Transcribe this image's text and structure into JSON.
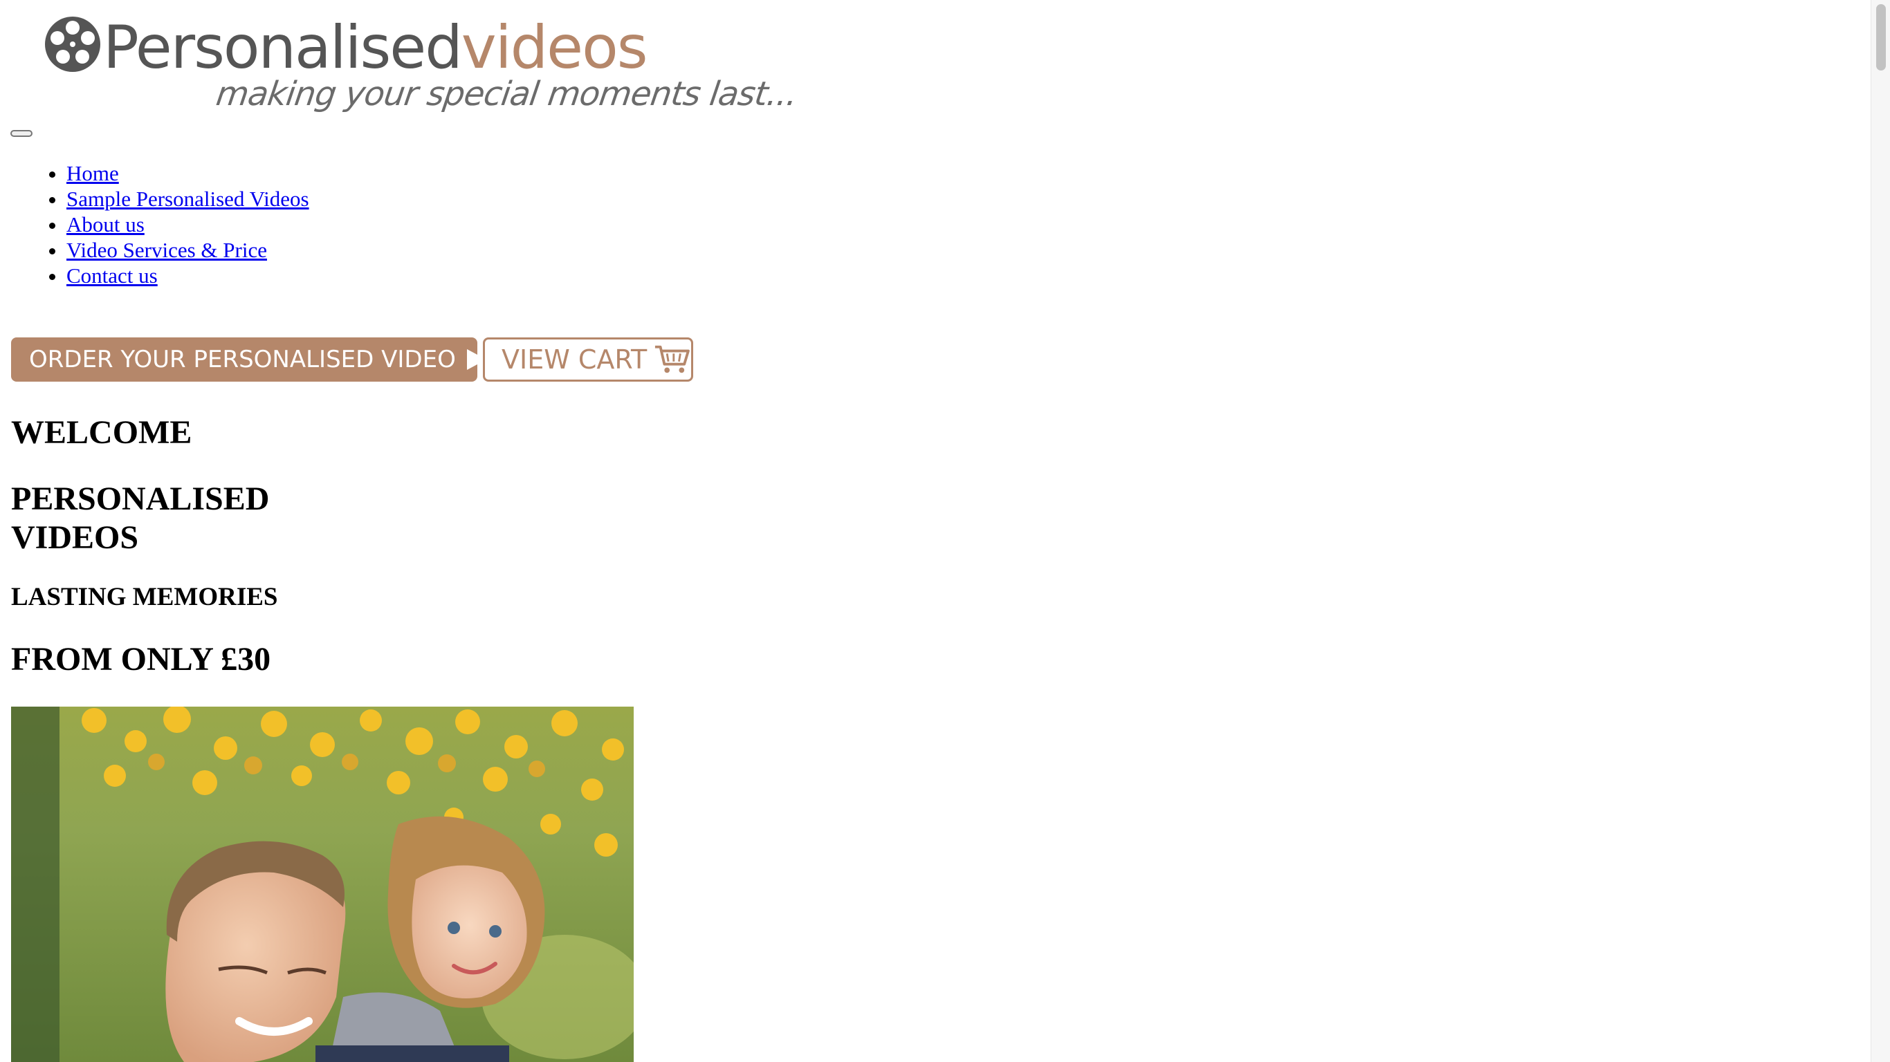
{
  "logo": {
    "brand_part1": "Personalised",
    "brand_part2": "videos",
    "tagline": "making your special moments last...",
    "reel_icon": "film-reel-icon"
  },
  "nav": {
    "items": [
      {
        "label": "Home"
      },
      {
        "label": "Sample Personalised Videos"
      },
      {
        "label": "About us"
      },
      {
        "label": "Video Services & Price"
      },
      {
        "label": "Contact us"
      }
    ]
  },
  "actions": {
    "order_label": "ORDER YOUR PERSONALISED VIDEO",
    "cart_label": "VIEW CART",
    "order_icon": "play-icon",
    "cart_icon": "shopping-cart-icon"
  },
  "headings": {
    "welcome": "WELCOME",
    "personalised_videos": "PERSONALISED VIDEOS",
    "lasting_memories": "LASTING MEMORIES",
    "price": "FROM ONLY £30"
  },
  "colors": {
    "accent": "#b5876a",
    "logo_text": "#555555",
    "link": "#0000ee"
  }
}
